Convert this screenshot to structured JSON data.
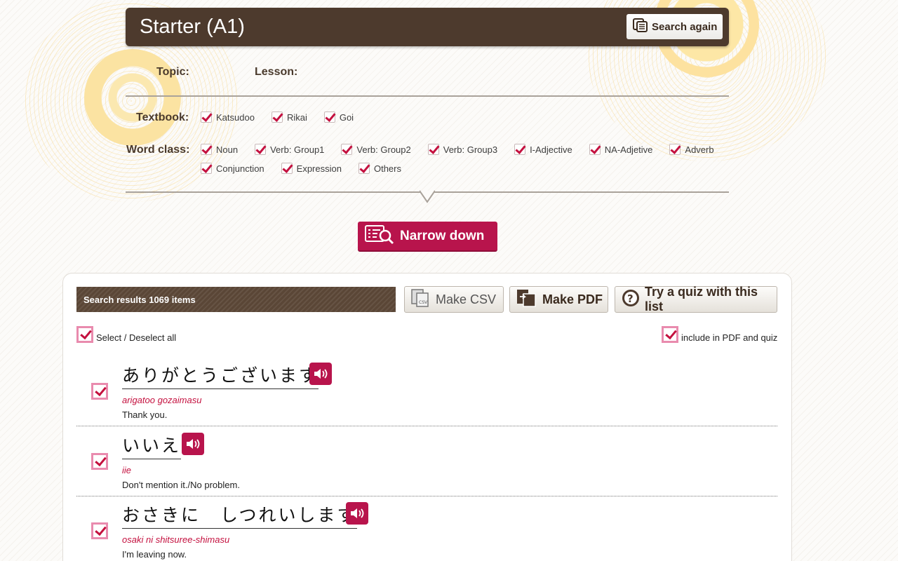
{
  "header": {
    "title": "Starter (A1)",
    "search_again_label": "Search again"
  },
  "filters": {
    "topic_label": "Topic:",
    "lesson_label": "Lesson:",
    "textbook_label": "Textbook:",
    "textbooks": [
      "Katsudoo",
      "Rikai",
      "Goi"
    ],
    "word_class_label": "Word class:",
    "word_classes_row1": [
      "Noun",
      "Verb: Group1",
      "Verb: Group2",
      "Verb: Group3",
      "I-Adjective",
      "NA-Adjetive",
      "Adverb"
    ],
    "word_classes_row2": [
      "Conjunction",
      "Expression",
      "Others"
    ],
    "narrow_down_label": "Narrow down"
  },
  "results": {
    "count_text": "Search results 1069 items",
    "make_csv_label": "Make CSV",
    "make_pdf_label": "Make PDF",
    "quiz_label": "Try a quiz with this list",
    "select_all_label": "Select / Deselect all",
    "include_label": "include in PDF and quiz",
    "items": [
      {
        "japanese": "ありがとうございます",
        "romaji": "arigatoo gozaimasu",
        "meaning": "Thank you."
      },
      {
        "japanese": "いいえ",
        "romaji": "iie",
        "meaning": "Don't mention it./No problem."
      },
      {
        "japanese": "おさきに　しつれいします",
        "romaji": "osaki ni shitsuree-shimasu",
        "meaning": "I'm leaving now."
      }
    ]
  },
  "colors": {
    "header_bg": "#4d3a2d",
    "accent": "#b8144c",
    "checkbox_border": "#e98bae"
  },
  "icons": {
    "search_again": "copy-icon",
    "narrow_down": "list-search-icon",
    "csv": "csv-file-icon",
    "pdf": "pdf-file-icon",
    "quiz": "question-circle-icon",
    "audio": "speaker-icon"
  }
}
